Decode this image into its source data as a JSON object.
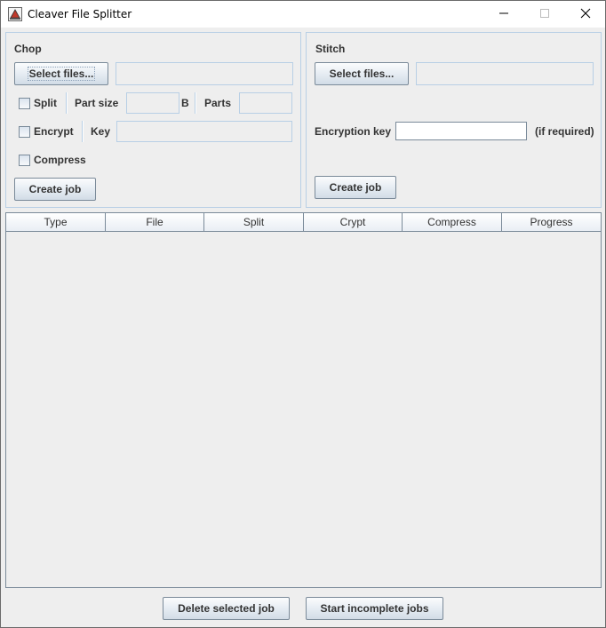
{
  "window": {
    "title": "Cleaver File Splitter",
    "controls": {
      "minimize": "minimize-icon",
      "maximize": "maximize-icon",
      "close": "close-icon"
    }
  },
  "chop": {
    "title": "Chop",
    "select_files_label": "Select files...",
    "files_value": "",
    "split_label": "Split",
    "split_checked": false,
    "part_size_label": "Part size",
    "part_size_value": "",
    "part_size_unit": "B",
    "parts_label": "Parts",
    "parts_value": "",
    "encrypt_label": "Encrypt",
    "encrypt_checked": false,
    "key_label": "Key",
    "key_value": "",
    "compress_label": "Compress",
    "compress_checked": false,
    "create_job_label": "Create job"
  },
  "stitch": {
    "title": "Stitch",
    "select_files_label": "Select files...",
    "files_value": "",
    "encryption_key_label": "Encryption key",
    "encryption_key_value": "",
    "if_required_label": "(if required)",
    "create_job_label": "Create job"
  },
  "jobs_table": {
    "columns": [
      "Type",
      "File",
      "Split",
      "Crypt",
      "Compress",
      "Progress"
    ],
    "rows": []
  },
  "footer": {
    "delete_label": "Delete selected job",
    "start_label": "Start incomplete jobs"
  },
  "colors": {
    "background": "#eeeeee",
    "border": "#b8cfe5",
    "button_border": "#7a8a99",
    "text": "#333333"
  }
}
